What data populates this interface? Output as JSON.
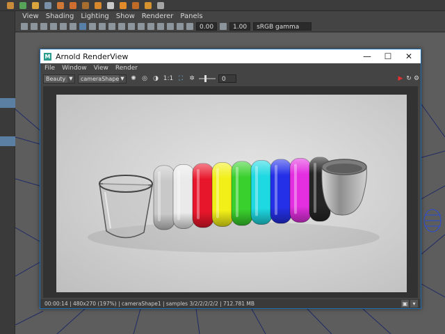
{
  "maya": {
    "panel_menu": [
      "View",
      "Shading",
      "Lighting",
      "Show",
      "Renderer",
      "Panels"
    ],
    "toolbar": {
      "field_a": "0.00",
      "field_b": "1.00",
      "color_space": "sRGB gamma"
    }
  },
  "renderview": {
    "title": "Arnold RenderView",
    "window_buttons": {
      "minimize": "—",
      "maximize": "☐",
      "close": "✕"
    },
    "menu": [
      "File",
      "Window",
      "View",
      "Render"
    ],
    "toolbar": {
      "aov": "Beauty",
      "camera": "cameraShape1",
      "ratio": "1:1",
      "exposure": "0"
    },
    "status": "00:00:14 | 480x270 (197%) | cameraShape1 | samples 3/2/2/2/2/2 | 712.781 MB"
  },
  "scene": {
    "glass_color": "#b9b9b9",
    "ring_colors": [
      "#c8c8c8",
      "#eaeaea",
      "#e8162a",
      "#f2ef18",
      "#39d02d",
      "#1ed8e2",
      "#2430e8",
      "#e32fe0",
      "#252525"
    ],
    "cup_color": "#a7a7a7",
    "background_color": "#e6e6e6"
  }
}
